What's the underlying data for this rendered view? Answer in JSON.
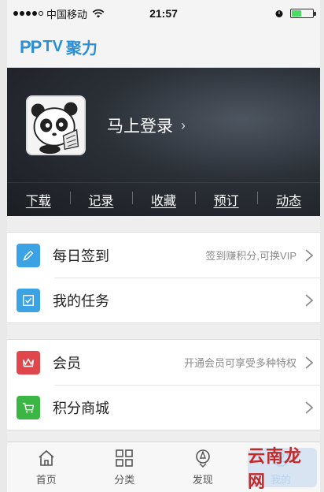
{
  "status_bar": {
    "carrier": "中国移动",
    "time": "21:57"
  },
  "brand": {
    "pp": "PP",
    "tv": "TV",
    "cn": "聚力"
  },
  "profile": {
    "login_label": "马上登录",
    "login_chevron": "›",
    "tabs": [
      {
        "label": "下载"
      },
      {
        "label": "记录"
      },
      {
        "label": "收藏"
      },
      {
        "label": "预订"
      },
      {
        "label": "动态"
      }
    ]
  },
  "menu_section_1": [
    {
      "label": "每日签到",
      "desc": "签到赚积分,可换VIP",
      "icon": "pen-sign-icon",
      "color": "#3ba3e3"
    },
    {
      "label": "我的任务",
      "desc": "",
      "icon": "checkbox-icon",
      "color": "#3ba3e3"
    }
  ],
  "menu_section_2": [
    {
      "label": "会员",
      "desc": "开通会员可享受多种特权",
      "icon": "crown-icon",
      "color": "#e0474c"
    },
    {
      "label": "积分商城",
      "desc": "",
      "icon": "cart-icon",
      "color": "#3bb543"
    }
  ],
  "tab_bar": [
    {
      "label": "首页",
      "icon": "home-icon"
    },
    {
      "label": "分类",
      "icon": "grid-icon"
    },
    {
      "label": "发现",
      "icon": "compass-icon"
    },
    {
      "label": "我的",
      "icon": "user-icon",
      "active": true
    }
  ],
  "watermark": {
    "text": "云南龙网"
  }
}
